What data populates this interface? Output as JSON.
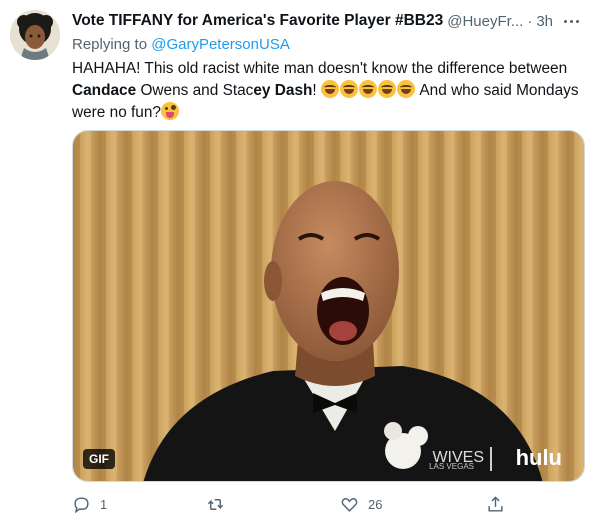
{
  "tweet": {
    "display_name": "Vote TIFFANY for America's Favorite Player #BB23",
    "handle": "@HueyFr...",
    "separator": "·",
    "time": "3h",
    "replying_prefix": "Replying to",
    "replying_to": "@GaryPetersonUSA",
    "text": {
      "part1": "HAHAHA! This old racist white man doesn't know the difference between",
      "bold1": "Candace",
      "part2": "Owens and Stac",
      "bold2": "ey Dash",
      "part3": "!",
      "part4": "And who said Mondays were no fun?"
    },
    "media": {
      "badge": "GIF",
      "watermark_show": "WIVES",
      "watermark_sub": "LAS VEGAS",
      "watermark_network": "hulu"
    },
    "actions": {
      "reply_count": "1",
      "retweet_count": "",
      "like_count": "26"
    }
  },
  "colors": {
    "link": "#1d9bf0",
    "secondary_text": "#536471",
    "primary_text": "#0f1419",
    "curtain": "#c9a25e"
  },
  "icons": {
    "avatar": "cartoon-avatar-icon",
    "more": "more-icon",
    "reply": "reply-icon",
    "retweet": "retweet-icon",
    "like": "like-icon",
    "share": "share-icon"
  }
}
